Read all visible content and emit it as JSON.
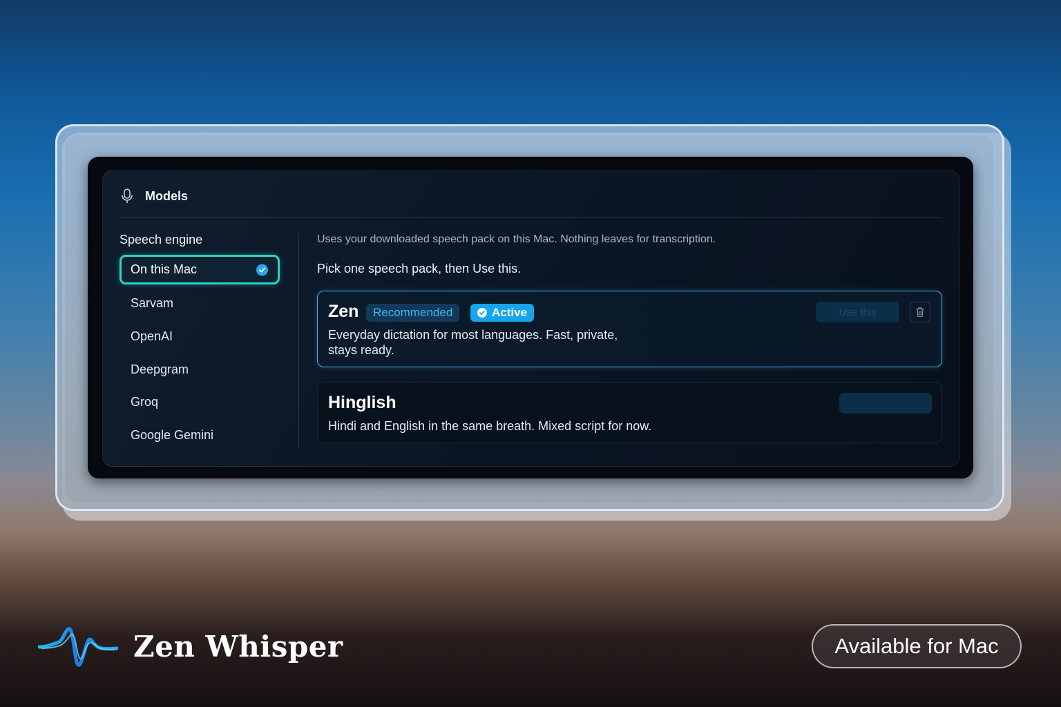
{
  "header": {
    "title": "Models",
    "icon": "microphone-icon"
  },
  "sidebar": {
    "heading": "Speech engine",
    "items": [
      {
        "label": "On this Mac",
        "selected": true
      },
      {
        "label": "Sarvam",
        "selected": false
      },
      {
        "label": "OpenAI",
        "selected": false
      },
      {
        "label": "Deepgram",
        "selected": false
      },
      {
        "label": "Groq",
        "selected": false
      },
      {
        "label": "Google Gemini",
        "selected": false
      }
    ]
  },
  "main": {
    "description": "Uses your downloaded speech pack on this Mac. Nothing leaves for transcription.",
    "instruction": "Pick one speech pack, then Use this.",
    "packs": [
      {
        "name": "Zen",
        "badges": {
          "recommended": "Recommended",
          "active": "Active"
        },
        "description_line1": "Everyday dictation for most languages. Fast, private,",
        "description_line2": "stays ready.",
        "use_label": "Use this",
        "state": "active"
      },
      {
        "name": "Hinglish",
        "description": "Hindi and English in the same breath. Mixed script for now.",
        "use_label": "",
        "state": "available"
      }
    ]
  },
  "brand": {
    "name": "Zen Whisper",
    "cta": "Available for Mac"
  },
  "colors": {
    "accent": "#14a5ec",
    "selection_outline": "#2fd4c4",
    "panel_bg": "#0b1726"
  }
}
